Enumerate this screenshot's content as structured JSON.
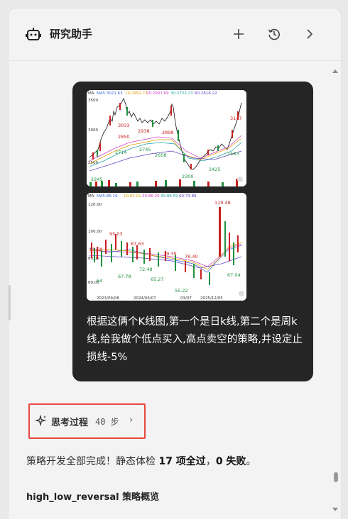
{
  "header": {
    "title": "研究助手",
    "icons": [
      "robot-icon",
      "plus-icon",
      "history-icon",
      "chevron-right-icon"
    ]
  },
  "message": {
    "text": "根据这俩个K线图,第一个是日k线,第二个是周k线,给我做个低点买入,高点卖空的策略,并设定止损线-5%"
  },
  "chart_daily": {
    "legend": [
      "MA",
      "MA5:3021.63",
      "10:2952.73",
      "20:2907.69",
      "30:2722.23",
      "60:2616.22"
    ],
    "y_ticks": [
      "3500",
      "3000",
      "2500"
    ],
    "annotations": [
      "3033",
      "2938",
      "2850",
      "2898",
      "2714",
      "2745",
      "2658",
      "2300",
      "2425",
      "2583",
      "3147",
      "2245"
    ]
  },
  "chart_weekly": {
    "legend": [
      "MA",
      "MA5:86.16",
      "10:82.01",
      "20:86.20",
      "30:86.59",
      "60:73.86"
    ],
    "y_ticks": [
      "120.00",
      "100.00",
      "80.00",
      "60.00"
    ],
    "annotations": [
      "119.48",
      "95.03",
      "87.63",
      "85.38",
      "79.39",
      "78.40",
      "72.48",
      "67.78",
      "65.27",
      "64",
      "55.22",
      "67.04"
    ],
    "x_ticks": [
      "2023/09/08",
      "2024/06/07",
      "03/07",
      "2025/12/05"
    ]
  },
  "thinking": {
    "label": "思考过程",
    "steps": "40 步",
    "chevron": "›"
  },
  "summary": {
    "prefix": "策略开发全部完成！静态体检 ",
    "bold1": "17 项全过",
    "middle": "，",
    "bold2": "0 失败",
    "suffix": "。"
  },
  "section": {
    "title": "high_low_reversal 策略概览"
  }
}
